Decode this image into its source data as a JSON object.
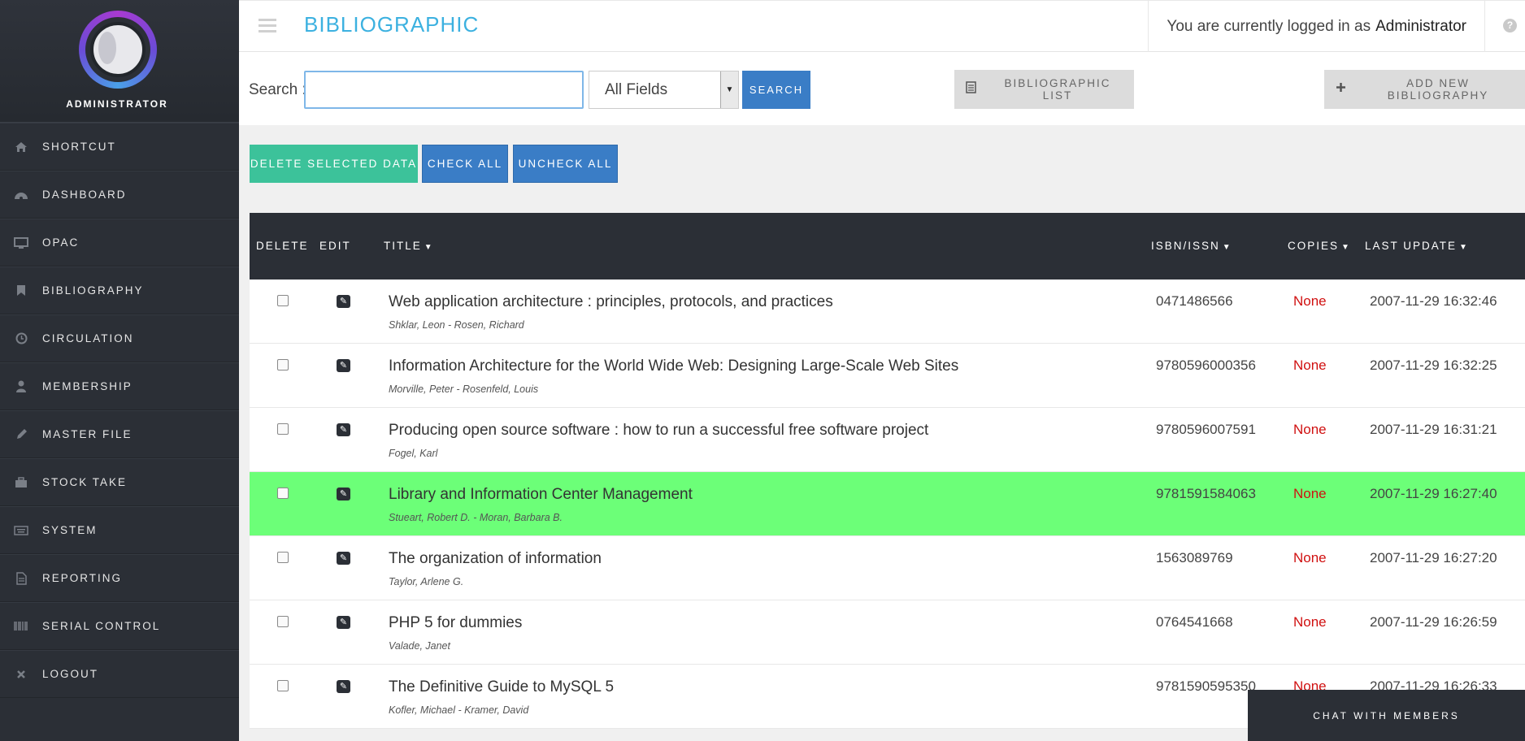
{
  "sidebar": {
    "user_label": "ADMINISTRATOR",
    "items": [
      {
        "label": "SHORTCUT",
        "icon": "home-icon"
      },
      {
        "label": "DASHBOARD",
        "icon": "dashboard-icon"
      },
      {
        "label": "OPAC",
        "icon": "monitor-icon"
      },
      {
        "label": "BIBLIOGRAPHY",
        "icon": "bookmark-icon"
      },
      {
        "label": "CIRCULATION",
        "icon": "clock-icon"
      },
      {
        "label": "MEMBERSHIP",
        "icon": "user-icon"
      },
      {
        "label": "MASTER FILE",
        "icon": "pencil-icon"
      },
      {
        "label": "STOCK TAKE",
        "icon": "briefcase-icon"
      },
      {
        "label": "SYSTEM",
        "icon": "keyboard-icon"
      },
      {
        "label": "REPORTING",
        "icon": "file-icon"
      },
      {
        "label": "SERIAL CONTROL",
        "icon": "barcode-icon"
      },
      {
        "label": "LOGOUT",
        "icon": "close-icon"
      }
    ]
  },
  "header": {
    "title": "BIBLIOGRAPHIC",
    "login_prefix": "You are currently logged in as",
    "login_user": "Administrator",
    "help": "?"
  },
  "search": {
    "label": "Search :",
    "value": "",
    "field": "All Fields",
    "button": "SEARCH",
    "list_button": "BIBLIOGRAPHIC LIST",
    "add_button": "ADD NEW BIBLIOGRAPHY"
  },
  "actions": {
    "delete": "DELETE SELECTED DATA",
    "check_all": "CHECK ALL",
    "uncheck_all": "UNCHECK ALL"
  },
  "table": {
    "headers": {
      "delete": "DELETE",
      "edit": "EDIT",
      "title": "TITLE",
      "isbn": "ISBN/ISSN",
      "copies": "COPIES",
      "last_update": "LAST UPDATE"
    },
    "rows": [
      {
        "title": "Web application architecture : principles, protocols, and practices",
        "author": "Shklar, Leon - Rosen, Richard",
        "isbn": "0471486566",
        "copies": "None",
        "updated": "2007-11-29 16:32:46"
      },
      {
        "title": "Information Architecture for the World Wide Web: Designing Large-Scale Web Sites",
        "author": "Morville, Peter - Rosenfeld, Louis",
        "isbn": "9780596000356",
        "copies": "None",
        "updated": "2007-11-29 16:32:25"
      },
      {
        "title": "Producing open source software : how to run a successful free software project",
        "author": "Fogel, Karl",
        "isbn": "9780596007591",
        "copies": "None",
        "updated": "2007-11-29 16:31:21"
      },
      {
        "title": "Library and Information Center Management",
        "author": "Stueart, Robert D. - Moran, Barbara B.",
        "isbn": "9781591584063",
        "copies": "None",
        "updated": "2007-11-29 16:27:40"
      },
      {
        "title": "The organization of information",
        "author": "Taylor, Arlene G.",
        "isbn": "1563089769",
        "copies": "None",
        "updated": "2007-11-29 16:27:20"
      },
      {
        "title": "PHP 5 for dummies",
        "author": "Valade, Janet",
        "isbn": "0764541668",
        "copies": "None",
        "updated": "2007-11-29 16:26:59"
      },
      {
        "title": "The Definitive Guide to MySQL 5",
        "author": "Kofler, Michael - Kramer, David",
        "isbn": "9781590595350",
        "copies": "None",
        "updated": "2007-11-29 16:26:33"
      }
    ]
  },
  "chat": {
    "label": "CHAT WITH MEMBERS"
  }
}
